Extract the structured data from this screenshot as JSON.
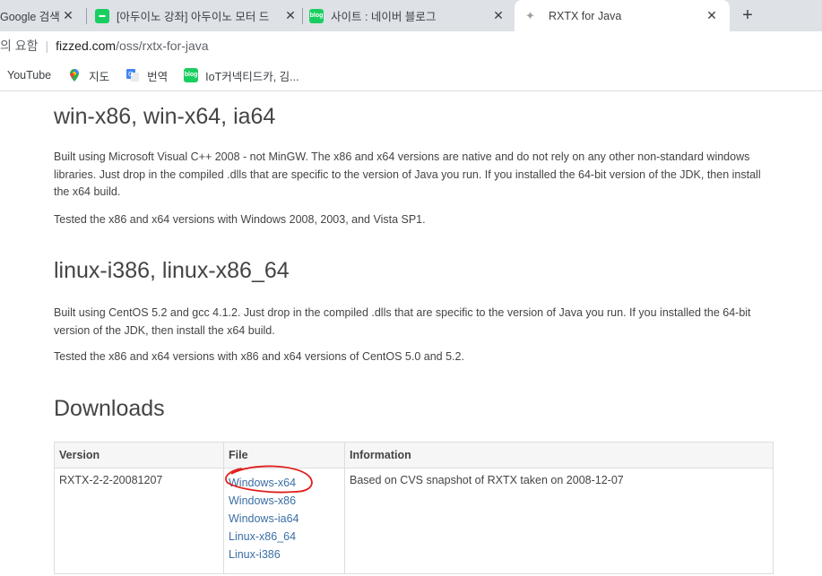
{
  "tabs": [
    {
      "title": "Google 검색",
      "active": false
    },
    {
      "title": "[아두이노 강좌] 아두이노 모터 드",
      "active": false
    },
    {
      "title": "사이트 : 네이버 블로그",
      "active": false
    },
    {
      "title": "RXTX for Java",
      "active": true
    }
  ],
  "address": {
    "prefix": "의 요함",
    "domain": "fizzed.com",
    "path": "/oss/rxtx-for-java"
  },
  "bookmarks": [
    {
      "label": "YouTube",
      "icon": "youtube-icon"
    },
    {
      "label": "지도",
      "icon": "maps-icon"
    },
    {
      "label": "번역",
      "icon": "translate-icon"
    },
    {
      "label": "IoT커넥티드카, 김...",
      "icon": "blog-icon"
    }
  ],
  "sections": [
    {
      "heading": "win-x86, win-x64, ia64",
      "paragraphs": [
        "Built using Microsoft Visual C++ 2008 - not MinGW. The x86 and x64 versions are native and do not rely on any other non-standard windows libraries. Just drop in the compiled .dlls that are specific to the version of Java you run. If you installed the 64-bit version of the JDK, then install the x64 build.",
        "Tested the x86 and x64 versions with Windows 2008, 2003, and Vista SP1."
      ]
    },
    {
      "heading": "linux-i386, linux-x86_64",
      "paragraphs": [
        "Built using CentOS 5.2 and gcc 4.1.2. Just drop in the compiled .dlls that are specific to the version of Java you run. If you installed the 64-bit version of the JDK, then install the x64 build.",
        "Tested the x86 and x64 versions with x86 and x64 versions of CentOS 5.0 and 5.2."
      ]
    }
  ],
  "downloads": {
    "heading": "Downloads",
    "columns": [
      "Version",
      "File",
      "Information"
    ],
    "row": {
      "version": "RXTX-2-2-20081207",
      "files": [
        "Windows-x64",
        "Windows-x86",
        "Windows-ia64",
        "Linux-x86_64",
        "Linux-i386"
      ],
      "info": "Based on CVS snapshot of RXTX taken on 2008-12-07"
    }
  },
  "colors": {
    "link": "#3a6ea5",
    "annotation": "#e0201c"
  }
}
